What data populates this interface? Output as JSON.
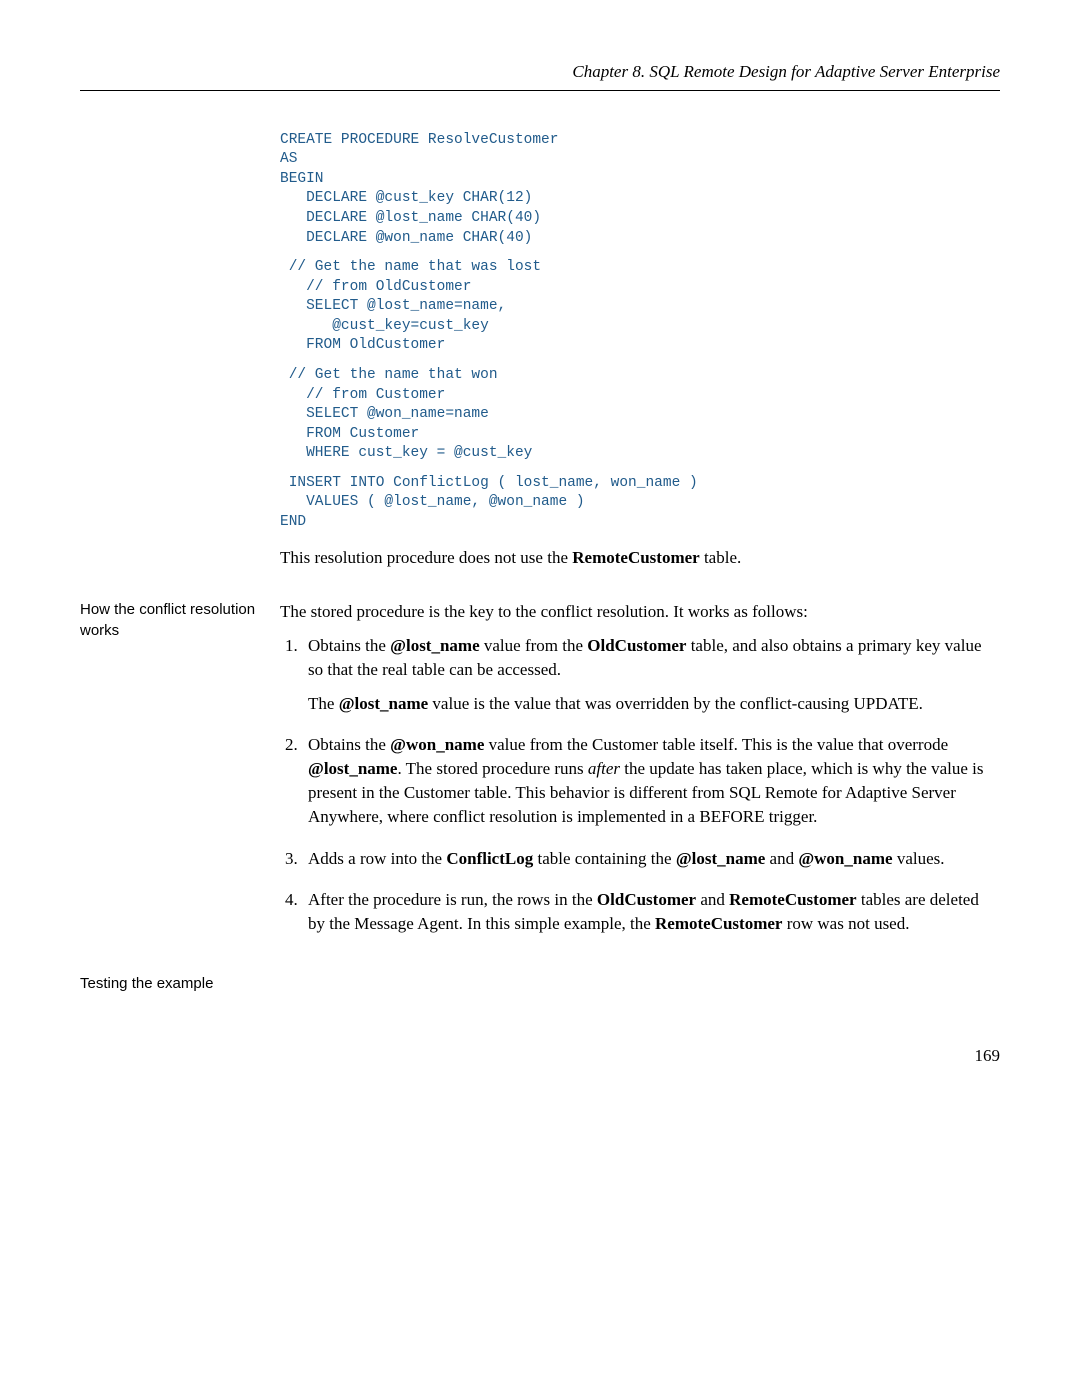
{
  "header": {
    "chapter_line": "Chapter 8.   SQL Remote Design for Adaptive Server Enterprise"
  },
  "code": {
    "block1": "CREATE PROCEDURE ResolveCustomer\nAS\nBEGIN\n   DECLARE @cust_key CHAR(12)\n   DECLARE @lost_name CHAR(40)\n   DECLARE @won_name CHAR(40)",
    "block2": " // Get the name that was lost\n   // from OldCustomer\n   SELECT @lost_name=name,\n      @cust_key=cust_key\n   FROM OldCustomer",
    "block3": " // Get the name that won\n   // from Customer\n   SELECT @won_name=name\n   FROM Customer\n   WHERE cust_key = @cust_key",
    "block4": " INSERT INTO ConflictLog ( lost_name, won_name )\n   VALUES ( @lost_name, @won_name )\nEND"
  },
  "para_after_code_prefix": "This resolution procedure does not use the ",
  "para_after_code_bold": "RemoteCustomer",
  "para_after_code_suffix": " table.",
  "sidebar": {
    "how_works": "How the conflict resolution works",
    "testing": "Testing the example"
  },
  "how_intro": "The stored procedure is the key to the conflict resolution. It works as follows:",
  "list": {
    "item1_a": "Obtains the ",
    "item1_b": "@lost_name",
    "item1_c": " value from the ",
    "item1_d": "OldCustomer",
    "item1_e": " table, and also obtains a primary key value so that the real table can be accessed.",
    "item1_sub_a": "The ",
    "item1_sub_b": "@lost_name",
    "item1_sub_c": " value is the value that was overridden by the conflict-causing UPDATE.",
    "item2_a": "Obtains the ",
    "item2_b": "@won_name",
    "item2_c": " value from the Customer table itself. This is the value that overrode ",
    "item2_d": "@lost_name",
    "item2_e": ". The stored procedure runs ",
    "item2_f_italic": "after",
    "item2_g": " the update has taken place, which is why the value is present in the Customer table. This behavior is different from SQL Remote for Adaptive Server Anywhere, where conflict resolution is implemented in a BEFORE trigger.",
    "item3_a": "Adds a row into the ",
    "item3_b": "ConflictLog",
    "item3_c": " table containing the ",
    "item3_d": "@lost_name",
    "item3_e": " and ",
    "item3_f": "@won_name",
    "item3_g": " values.",
    "item4_a": "After the procedure is run, the rows in the ",
    "item4_b": "OldCustomer",
    "item4_c": " and ",
    "item4_d": "RemoteCustomer",
    "item4_e": " tables are deleted by the Message Agent. In this simple example, the ",
    "item4_f": "RemoteCustomer",
    "item4_g": " row was not used."
  },
  "page_number": "169"
}
